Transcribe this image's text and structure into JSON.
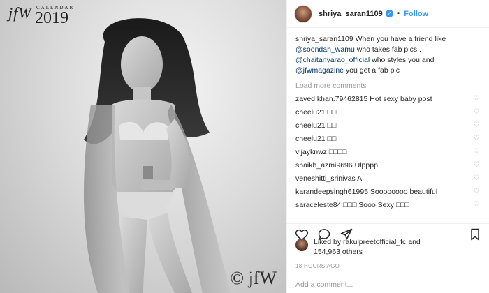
{
  "photo": {
    "brand_logo": "jfW",
    "brand_calendar": "CALENDAR",
    "brand_year": "2019",
    "copyright": "© jfW"
  },
  "post": {
    "header": {
      "username": "shriya_saran1109",
      "verified_icon": "verified-badge-icon",
      "separator": "•",
      "follow_label": "Follow"
    },
    "caption": {
      "username": "shriya_saran1109",
      "text_1": " When you have a friend like ",
      "mention_1": "@soondah_wamu",
      "text_2": " who takes fab pics . ",
      "mention_2": "@chaitanyarao_official",
      "text_3": " who styles you and ",
      "mention_3": "@jfwmagazine",
      "text_4": " you get a fab pic"
    },
    "load_more": "Load more comments",
    "comments": [
      {
        "username": "zaved.khan.79462815",
        "text": "Hot sexy baby post"
      },
      {
        "username": "cheelu21",
        "text": "□□"
      },
      {
        "username": "cheelu21",
        "text": "□□"
      },
      {
        "username": "cheelu21",
        "text": "□□"
      },
      {
        "username": "vijayknwz",
        "text": "□□□□"
      },
      {
        "username": "shaikh_azmi9696",
        "text": "Ulpppp"
      },
      {
        "username": "veneshitti_srinivas",
        "text": "A"
      },
      {
        "username": "karandeepsingh61995",
        "text": "Soooooooo beautiful"
      },
      {
        "username": "saraceleste84",
        "text": "□□□ Sooo Sexy □□□"
      }
    ],
    "actions": {
      "like_icon": "heart-icon",
      "comment_icon": "comment-icon",
      "share_icon": "share-icon",
      "save_icon": "bookmark-icon"
    },
    "likes": {
      "prefix": "Liked by ",
      "username": "rakulpreetofficial_fc",
      "middle": " and ",
      "count": "154,963 others"
    },
    "timestamp": "18 HOURS AGO",
    "add_comment_placeholder": "Add a comment..."
  },
  "colors": {
    "accent": "#3897f0",
    "mention": "#003569",
    "muted": "#999999",
    "text": "#262626",
    "divider": "#efefef"
  }
}
